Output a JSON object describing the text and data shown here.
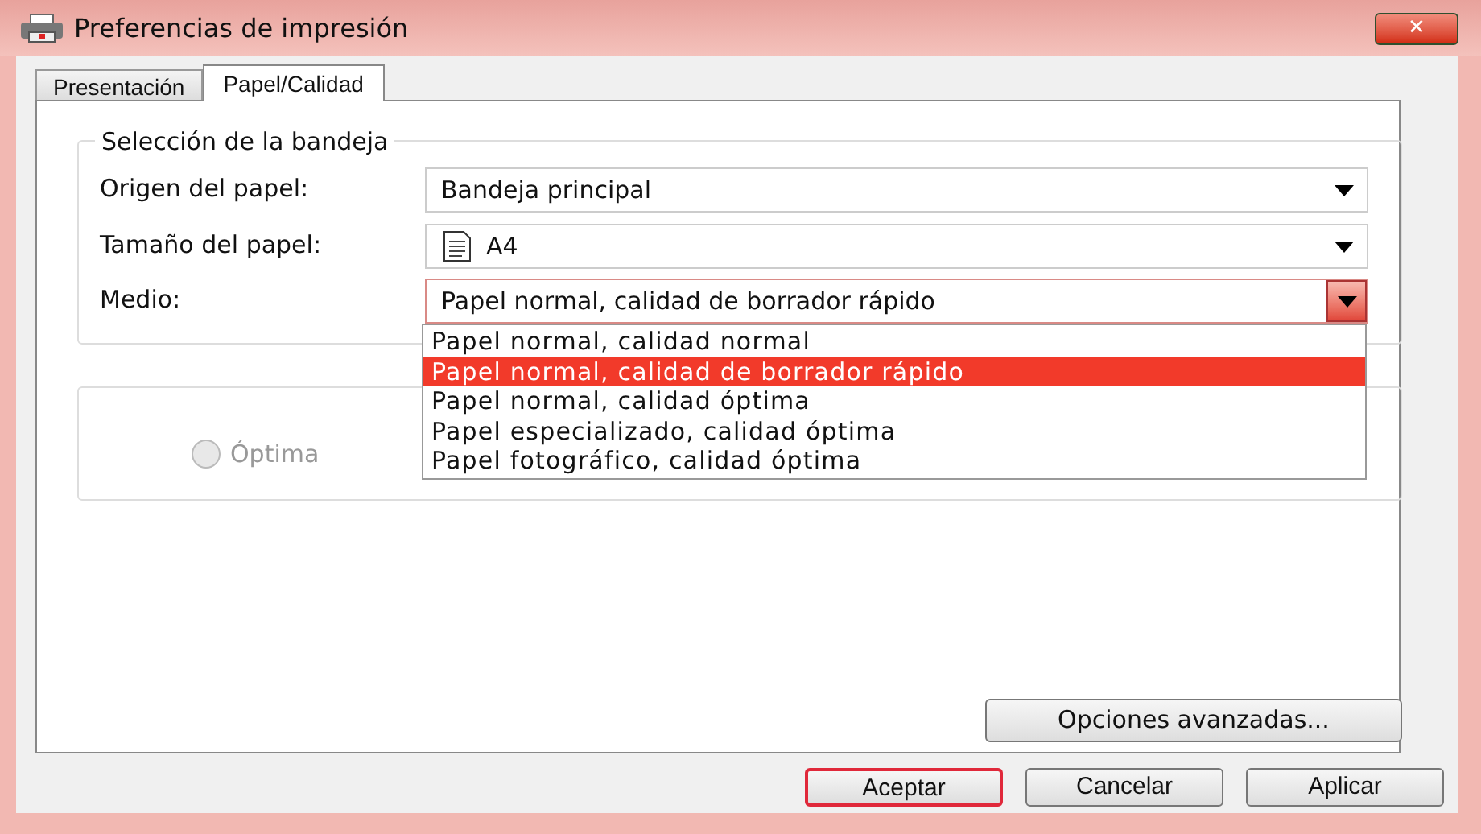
{
  "window": {
    "title": "Preferencias de impresión",
    "close_label": "✕"
  },
  "tabs": [
    {
      "label": "Presentación",
      "selected": false
    },
    {
      "label": "Papel/Calidad",
      "selected": true
    }
  ],
  "tray_group": {
    "title": "Selección de la bandeja",
    "fields": [
      {
        "label": "Origen del papel:",
        "value": "Bandeja principal",
        "kind": "plain",
        "focused": false
      },
      {
        "label": "Tamaño del papel:",
        "value": "A4",
        "kind": "page",
        "focused": false
      },
      {
        "label": "Medio:",
        "value": "Papel normal, calidad de borrador rápido",
        "kind": "plain",
        "focused": true
      }
    ]
  },
  "media_list": [
    {
      "label": "Papel normal, calidad normal",
      "selected": false
    },
    {
      "label": "Papel normal, calidad de borrador rápido",
      "selected": true
    },
    {
      "label": "Papel normal, calidad óptima",
      "selected": false
    },
    {
      "label": "Papel especializado, calidad óptima",
      "selected": false
    },
    {
      "label": "Papel fotográfico, calidad óptima",
      "selected": false
    }
  ],
  "quality_group": {
    "options": [
      {
        "label": "Óptima",
        "selected": false,
        "disabled": true
      }
    ]
  },
  "advanced_button": "Opciones avanzadas...",
  "buttons": [
    {
      "label": "Aceptar",
      "default": true
    },
    {
      "label": "Cancelar",
      "default": false
    },
    {
      "label": "Aplicar",
      "default": false
    }
  ]
}
